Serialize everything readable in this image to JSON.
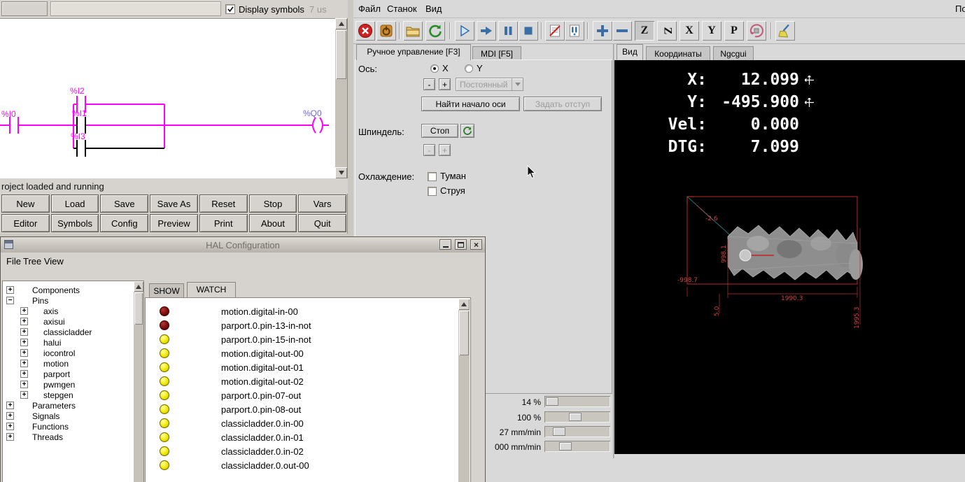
{
  "classicladder": {
    "display_symbols": "Display symbols",
    "scan_time": "7 us",
    "status": "roject loaded and running",
    "labels": {
      "i0": "%I0",
      "i1": "%I1",
      "i2": "%I2",
      "i3": "%I3",
      "q0": "%Q0"
    },
    "buttons_row1": [
      "New",
      "Load",
      "Save",
      "Save As",
      "Reset",
      "Stop",
      "Vars"
    ],
    "buttons_row2": [
      "Editor",
      "Symbols",
      "Config",
      "Preview",
      "Print",
      "About",
      "Quit"
    ]
  },
  "hal": {
    "title": "HAL Configuration",
    "menu": [
      "File",
      "Tree View"
    ],
    "tree_top1": [
      "Components",
      "Pins"
    ],
    "tree_children": [
      "axis",
      "axisui",
      "classicladder",
      "halui",
      "iocontrol",
      "motion",
      "parport",
      "pwmgen",
      "stepgen"
    ],
    "tree_top2": [
      "Parameters",
      "Signals",
      "Functions",
      "Threads"
    ],
    "tabs": [
      "SHOW",
      "WATCH"
    ],
    "watch": [
      {
        "label": "motion.digital-in-00",
        "led": "led red"
      },
      {
        "label": "parport.0.pin-13-in-not",
        "led": "led red"
      },
      {
        "label": "parport.0.pin-15-in-not",
        "led": "led yellow"
      },
      {
        "label": "motion.digital-out-00",
        "led": "led yellow"
      },
      {
        "label": "motion.digital-out-01",
        "led": "led yellow"
      },
      {
        "label": "motion.digital-out-02",
        "led": "led yellow"
      },
      {
        "label": "parport.0.pin-07-out",
        "led": "led yellow"
      },
      {
        "label": "parport.0.pin-08-out",
        "led": "led yellow"
      },
      {
        "label": "classicladder.0.in-00",
        "led": "led yellow"
      },
      {
        "label": "classicladder.0.in-01",
        "led": "led yellow"
      },
      {
        "label": "classicladder.0.in-02",
        "led": "led yellow"
      },
      {
        "label": "classicladder.0.out-00",
        "led": "led yellow"
      }
    ]
  },
  "axis": {
    "menu": [
      "Файл",
      "Станок",
      "Вид"
    ],
    "menu_clipped": "По",
    "toolbar_icons": [
      "estop",
      "machine-on",
      "open-file",
      "reload",
      "run",
      "step",
      "pause",
      "stop",
      "skip-lines",
      "optional-stop",
      "zoom-in",
      "zoom-out",
      "view-top",
      "view-rotated-top",
      "view-side",
      "view-front",
      "view-perspective",
      "rotate-view",
      "clear-plot"
    ],
    "view_letters": [
      "Z",
      "Z",
      "X",
      "Y",
      "P"
    ],
    "left_tabs": [
      "Ручное управление [F3]",
      "MDI [F5]"
    ],
    "manual": {
      "axis_label": "Ось:",
      "radio_x": "X",
      "radio_y": "Y",
      "minus": "-",
      "plus": "+",
      "jog_mode": "Постоянный",
      "home_axis": "Найти начало оси",
      "set_offset": "Задать отступ",
      "spindle_label": "Шпиндель:",
      "spindle_stop": "Стоп",
      "coolant_label": "Охлаждение:",
      "mist": "Туман",
      "flood": "Струя"
    },
    "sliders": [
      "14 %",
      "100 %",
      "27 mm/min",
      "000 mm/min"
    ],
    "right_tabs": [
      "Вид",
      "Координаты",
      "Ngcgui"
    ],
    "dro": {
      "rows": [
        {
          "label": "X:",
          "value": "12.099",
          "homed": true
        },
        {
          "label": "Y:",
          "value": "-495.900",
          "homed": true
        },
        {
          "label": "Vel:",
          "value": "0.000",
          "homed": false
        },
        {
          "label": "DTG:",
          "value": "7.099",
          "homed": false
        }
      ]
    },
    "preview": {
      "dim_top": "-2.6",
      "dim_left_v": "998.1",
      "dim_bottom_left": "-998.7",
      "dim_small_v": "5.0",
      "dim_bottom": "1990.3",
      "dim_right_v": "1995.3"
    }
  }
}
